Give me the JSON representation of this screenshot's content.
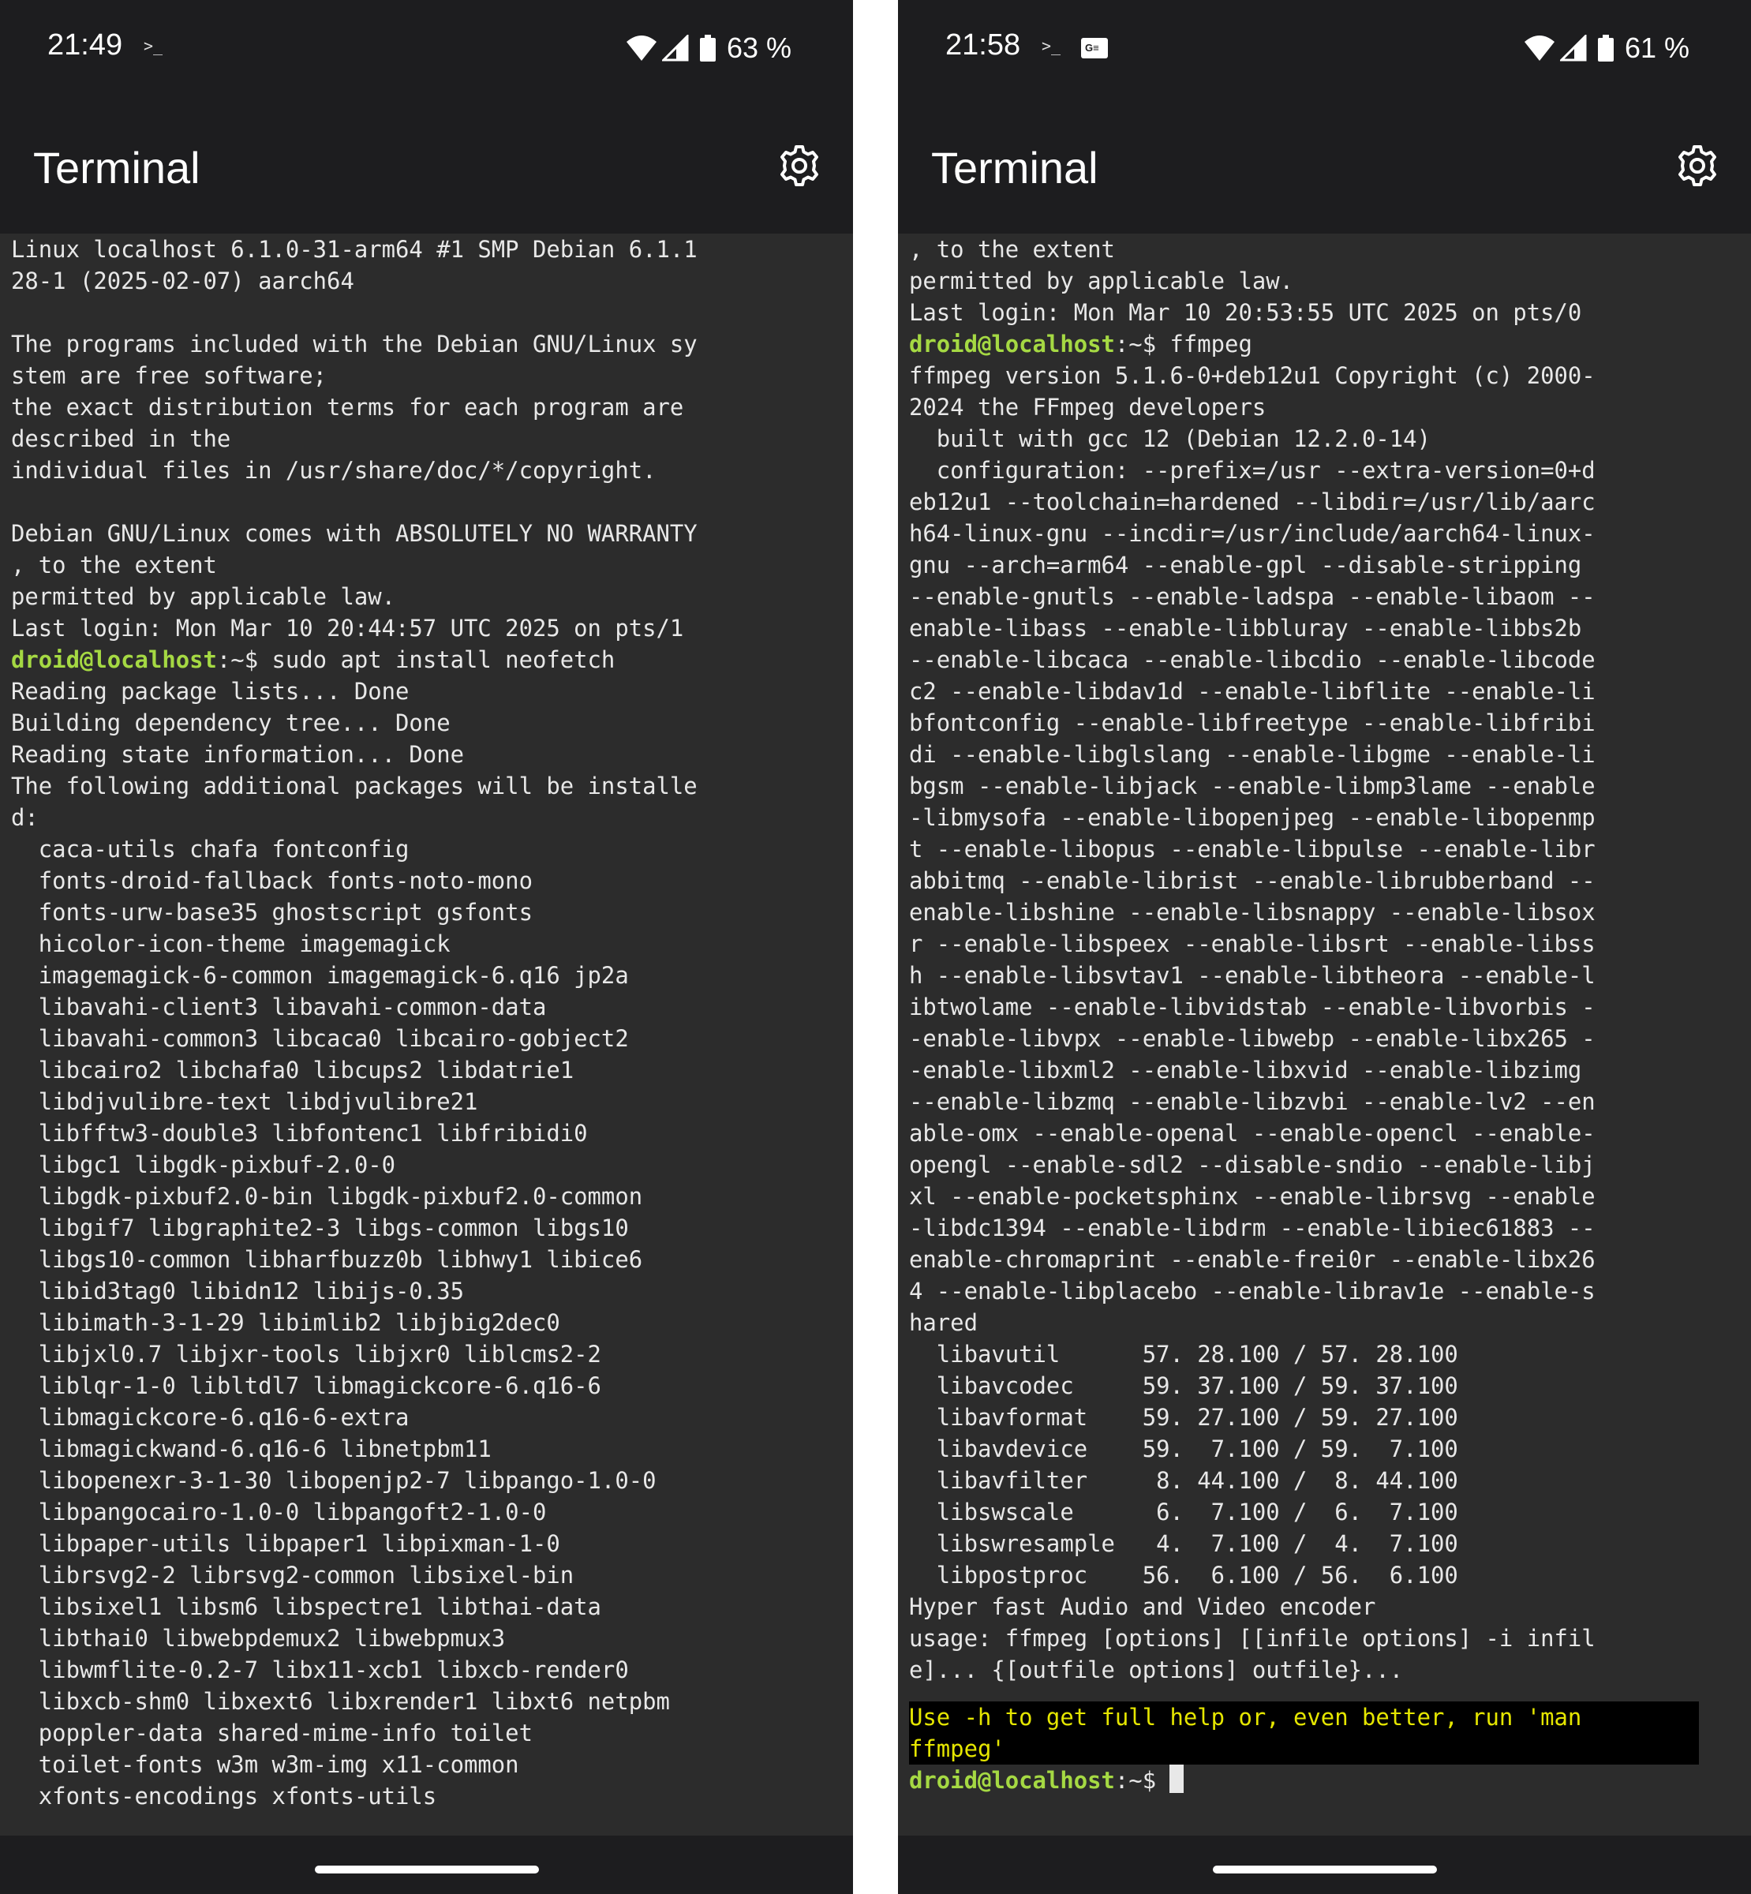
{
  "left": {
    "status": {
      "time": "21:49",
      "battery": "63 %",
      "prompt_glyph": ">_"
    },
    "app_title": "Terminal",
    "terminal_lines": [
      "Linux localhost 6.1.0-31-arm64 #1 SMP Debian 6.1.1",
      "28-1 (2025-02-07) aarch64",
      "",
      "The programs included with the Debian GNU/Linux sy",
      "stem are free software;",
      "the exact distribution terms for each program are",
      "described in the",
      "individual files in /usr/share/doc/*/copyright.",
      "",
      "Debian GNU/Linux comes with ABSOLUTELY NO WARRANTY",
      ", to the extent",
      "permitted by applicable law.",
      "Last login: Mon Mar 10 20:44:57 UTC 2025 on pts/1"
    ],
    "prompt": {
      "user": "droid@localhost",
      "path": ":~$ ",
      "command": "sudo apt install neofetch"
    },
    "output_lines": [
      "Reading package lists... Done",
      "Building dependency tree... Done",
      "Reading state information... Done",
      "The following additional packages will be installe",
      "d:",
      "  caca-utils chafa fontconfig",
      "  fonts-droid-fallback fonts-noto-mono",
      "  fonts-urw-base35 ghostscript gsfonts",
      "  hicolor-icon-theme imagemagick",
      "  imagemagick-6-common imagemagick-6.q16 jp2a",
      "  libavahi-client3 libavahi-common-data",
      "  libavahi-common3 libcaca0 libcairo-gobject2",
      "  libcairo2 libchafa0 libcups2 libdatrie1",
      "  libdjvulibre-text libdjvulibre21",
      "  libfftw3-double3 libfontenc1 libfribidi0",
      "  libgc1 libgdk-pixbuf-2.0-0",
      "  libgdk-pixbuf2.0-bin libgdk-pixbuf2.0-common",
      "  libgif7 libgraphite2-3 libgs-common libgs10",
      "  libgs10-common libharfbuzz0b libhwy1 libice6",
      "  libid3tag0 libidn12 libijs-0.35",
      "  libimath-3-1-29 libimlib2 libjbig2dec0",
      "  libjxl0.7 libjxr-tools libjxr0 liblcms2-2",
      "  liblqr-1-0 libltdl7 libmagickcore-6.q16-6",
      "  libmagickcore-6.q16-6-extra",
      "  libmagickwand-6.q16-6 libnetpbm11",
      "  libopenexr-3-1-30 libopenjp2-7 libpango-1.0-0",
      "  libpangocairo-1.0-0 libpangoft2-1.0-0",
      "  libpaper-utils libpaper1 libpixman-1-0",
      "  librsvg2-2 librsvg2-common libsixel-bin",
      "  libsixel1 libsm6 libspectre1 libthai-data",
      "  libthai0 libwebpdemux2 libwebpmux3",
      "  libwmflite-0.2-7 libx11-xcb1 libxcb-render0",
      "  libxcb-shm0 libxext6 libxrender1 libxt6 netpbm",
      "  poppler-data shared-mime-info toilet",
      "  toilet-fonts w3m w3m-img x11-common",
      "  xfonts-encodings xfonts-utils"
    ]
  },
  "right": {
    "status": {
      "time": "21:58",
      "battery": "61 %",
      "prompt_glyph": ">_",
      "notification_icon": "G≡"
    },
    "app_title": "Terminal",
    "terminal_lines": [
      ", to the extent",
      "permitted by applicable law.",
      "Last login: Mon Mar 10 20:53:55 UTC 2025 on pts/0"
    ],
    "prompt": {
      "user": "droid@localhost",
      "path": ":~$ ",
      "command": "ffmpeg"
    },
    "output_lines": [
      "ffmpeg version 5.1.6-0+deb12u1 Copyright (c) 2000-",
      "2024 the FFmpeg developers",
      "  built with gcc 12 (Debian 12.2.0-14)",
      "  configuration: --prefix=/usr --extra-version=0+d",
      "eb12u1 --toolchain=hardened --libdir=/usr/lib/aarc",
      "h64-linux-gnu --incdir=/usr/include/aarch64-linux-",
      "gnu --arch=arm64 --enable-gpl --disable-stripping",
      "--enable-gnutls --enable-ladspa --enable-libaom --",
      "enable-libass --enable-libbluray --enable-libbs2b",
      "--enable-libcaca --enable-libcdio --enable-libcode",
      "c2 --enable-libdav1d --enable-libflite --enable-li",
      "bfontconfig --enable-libfreetype --enable-libfribi",
      "di --enable-libglslang --enable-libgme --enable-li",
      "bgsm --enable-libjack --enable-libmp3lame --enable",
      "-libmysofa --enable-libopenjpeg --enable-libopenmp",
      "t --enable-libopus --enable-libpulse --enable-libr",
      "abbitmq --enable-librist --enable-librubberband --",
      "enable-libshine --enable-libsnappy --enable-libsox",
      "r --enable-libspeex --enable-libsrt --enable-libss",
      "h --enable-libsvtav1 --enable-libtheora --enable-l",
      "ibtwolame --enable-libvidstab --enable-libvorbis -",
      "-enable-libvpx --enable-libwebp --enable-libx265 -",
      "-enable-libxml2 --enable-libxvid --enable-libzimg",
      "--enable-libzmq --enable-libzvbi --enable-lv2 --en",
      "able-omx --enable-openal --enable-opencl --enable-",
      "opengl --enable-sdl2 --disable-sndio --enable-libj",
      "xl --enable-pocketsphinx --enable-librsvg --enable",
      "-libdc1394 --enable-libdrm --enable-libiec61883 --",
      "enable-chromaprint --enable-frei0r --enable-libx26",
      "4 --enable-libplacebo --enable-librav1e --enable-s",
      "hared",
      "  libavutil      57. 28.100 / 57. 28.100",
      "  libavcodec     59. 37.100 / 59. 37.100",
      "  libavformat    59. 27.100 / 59. 27.100",
      "  libavdevice    59.  7.100 / 59.  7.100",
      "  libavfilter     8. 44.100 /  8. 44.100",
      "  libswscale      6.  7.100 /  6.  7.100",
      "  libswresample   4.  7.100 /  4.  7.100",
      "  libpostproc    56.  6.100 / 56.  6.100",
      "Hyper fast Audio and Video encoder",
      "usage: ffmpeg [options] [[infile options] -i infil",
      "e]... {[outfile options] outfile}..."
    ],
    "notice_lines": [
      "Use -h to get full help or, even better, run 'man",
      "ffmpeg'"
    ],
    "final_prompt": {
      "user": "droid@localhost",
      "path": ":~$ "
    }
  }
}
